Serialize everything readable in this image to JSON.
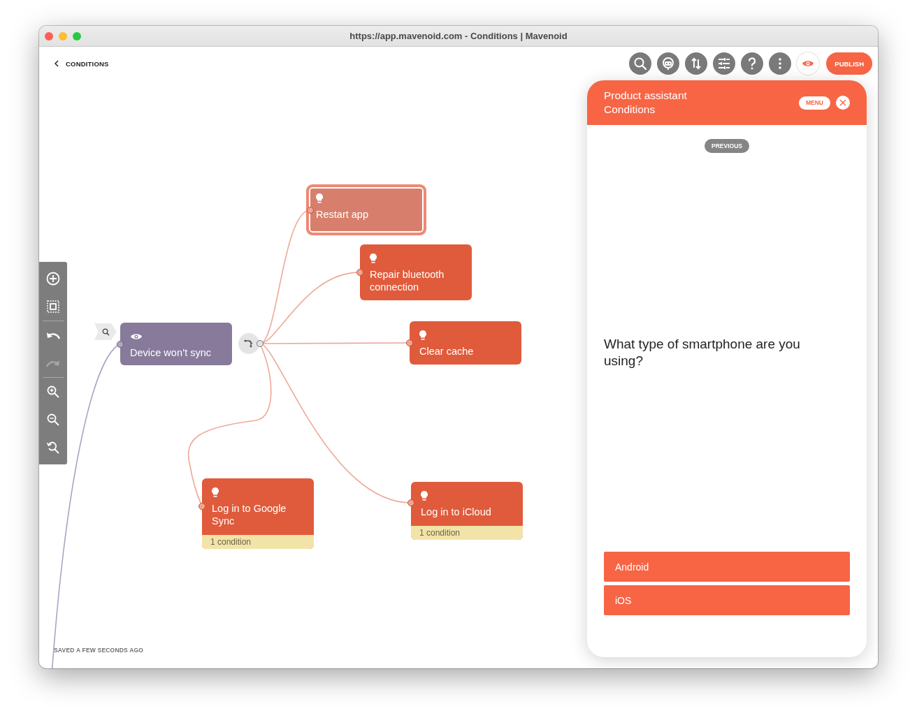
{
  "window": {
    "title": "https://app.mavenoid.com - Conditions | Mavenoid"
  },
  "header": {
    "back_label": "CONDITIONS",
    "publish_label": "PUBLISH"
  },
  "canvas": {
    "nodes": [
      {
        "kind": "question",
        "label": "Device won’t sync",
        "selected": false
      },
      {
        "kind": "solution",
        "label": "Restart app",
        "selected": true
      },
      {
        "kind": "solution",
        "label": "Repair bluetooth connection",
        "selected": false
      },
      {
        "kind": "solution",
        "label": "Clear cache",
        "selected": false
      },
      {
        "kind": "solution",
        "label": "Log in to Google Sync",
        "selected": false,
        "condition": "1 condition"
      },
      {
        "kind": "solution",
        "label": "Log in to iCloud",
        "selected": false,
        "condition": "1 condition"
      }
    ]
  },
  "save_status": "SAVED A FEW SECONDS AGO",
  "assistant": {
    "title": "Product assistant",
    "subtitle": "Conditions",
    "menu_label": "MENU",
    "previous_label": "PREVIOUS",
    "question": "What type of smartphone are you using?",
    "answers": [
      "Android",
      "iOS"
    ]
  }
}
